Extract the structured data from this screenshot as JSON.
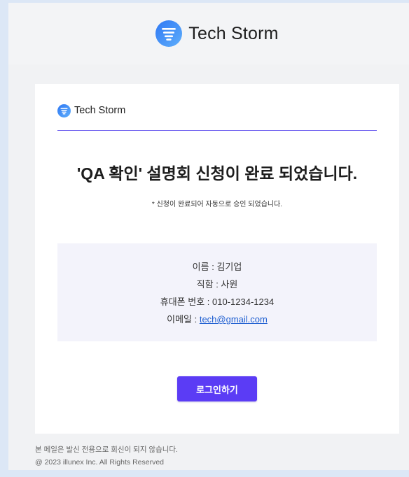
{
  "theme": {
    "accent": "#5b3cf5",
    "divider": "#6e5ff0",
    "link": "#1f5fd1",
    "logo_gradient_start": "#2f78f4",
    "logo_gradient_end": "#5eaefb",
    "info_background": "#f3f3fb"
  },
  "header": {
    "brand": "Tech Storm",
    "logo_icon": "storm-logo-icon"
  },
  "card": {
    "brand": "Tech Storm",
    "logo_icon": "storm-logo-icon",
    "title": "'QA 확인' 설명회 신청이 완료 되었습니다.",
    "note": "* 신청이 완료되어 자동으로 승인 되었습니다.",
    "info": [
      {
        "label": "이름 : ",
        "value": "김기업"
      },
      {
        "label": "직함 : ",
        "value": "사원"
      },
      {
        "label": "휴대폰 번호 : ",
        "value": "010-1234-1234"
      },
      {
        "label": "이메일 : ",
        "value": "tech@gmail.com"
      }
    ],
    "login_button": "로그인하기"
  },
  "footer": {
    "notice": "본 메일은 발신 전용으로 회신이 되지 않습니다.",
    "copyright": "@ 2023 illunex Inc. All Rights Reserved"
  }
}
